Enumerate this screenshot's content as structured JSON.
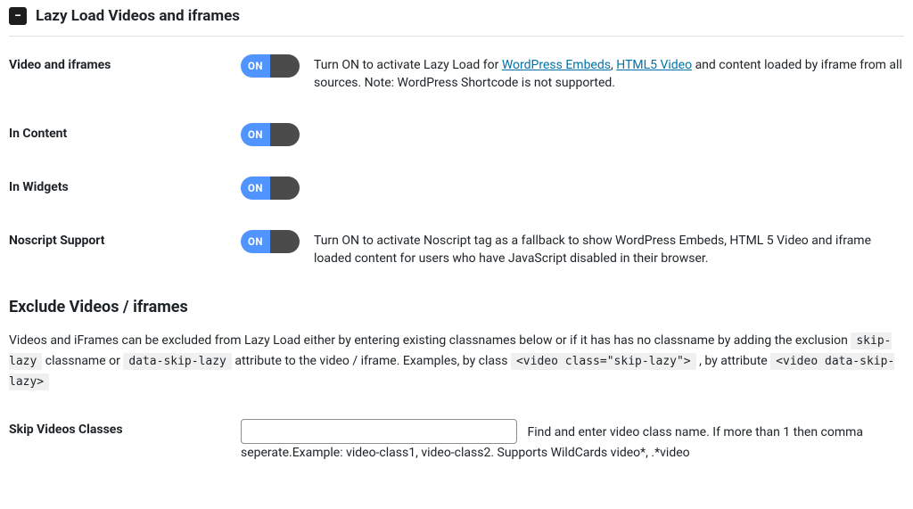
{
  "section": {
    "title": "Lazy Load Videos and iframes"
  },
  "toggles": {
    "on_label": "ON"
  },
  "rows": {
    "video_iframes": {
      "label": "Video and iframes",
      "desc_pre": "Turn ON to activate Lazy Load for ",
      "link1": "WordPress Embeds",
      "sep": ", ",
      "link2": "HTML5 Video",
      "desc_post": " and content loaded by iframe from all sources. Note: WordPress Shortcode is not supported."
    },
    "in_content": {
      "label": "In Content"
    },
    "in_widgets": {
      "label": "In Widgets"
    },
    "noscript": {
      "label": "Noscript Support",
      "desc": "Turn ON to activate Noscript tag as a fallback to show WordPress Embeds, HTML 5 Video and iframe loaded content for users who have JavaScript disabled in their browser."
    }
  },
  "exclude": {
    "title": "Exclude Videos / iframes",
    "desc_pre": "Videos and iFrames can be excluded from Lazy Load either by entering existing classnames below or if it has has no classname by adding the exclusion ",
    "code1": "skip-lazy",
    "mid1": " classname or ",
    "code2": "data-skip-lazy",
    "mid2": " attribute to the video / iframe. Examples, by class ",
    "code3": "<video class=\"skip-lazy\">",
    "mid3": " , by attribute ",
    "code4": "<video data-skip-lazy>"
  },
  "skip": {
    "label": "Skip Videos Classes",
    "value": "",
    "hint": "Find and enter video class name. If more than 1 then comma seperate.Example: video-class1, video-class2. Supports WildCards video*, .*video"
  }
}
